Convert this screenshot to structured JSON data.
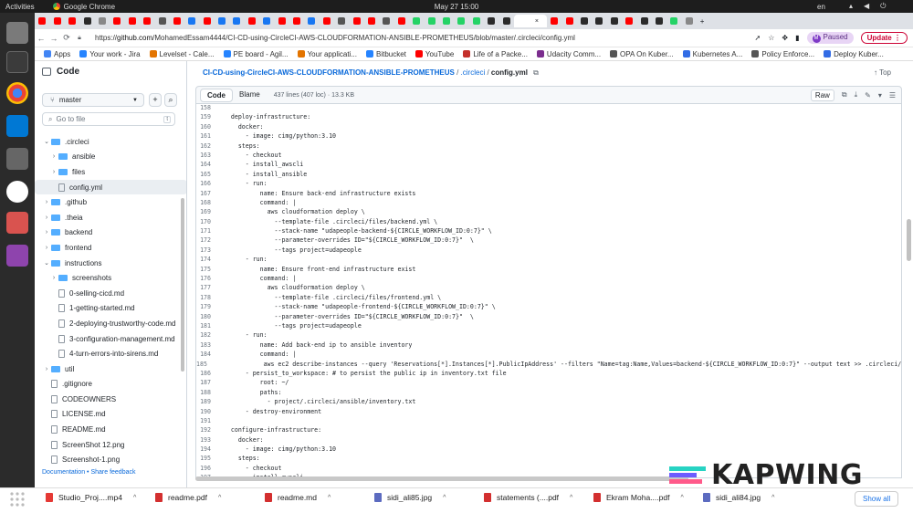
{
  "system": {
    "activities": "Activities",
    "app_name": "Google Chrome",
    "clock": "May 27  15:00",
    "lang": "en"
  },
  "browser": {
    "url_prefix": "https://",
    "url_host": "github.com",
    "url_path": "/MohamedEssam4444/CI-CD-using-CircleCI-AWS-CLOUDFORMATION-ANSIBLE-PROMETHEUS/blob/master/.circleci/config.yml",
    "paused_label": "Paused",
    "update_label": "Update",
    "avatar_letter": "M"
  },
  "bookmarks": [
    {
      "label": "Apps",
      "color": "#4285f4"
    },
    {
      "label": "Your work - Jira",
      "color": "#2684ff"
    },
    {
      "label": "Levelset - Cale...",
      "color": "#e37400"
    },
    {
      "label": "PE board - Agil...",
      "color": "#2684ff"
    },
    {
      "label": "Your applicati...",
      "color": "#e37400"
    },
    {
      "label": "Bitbucket",
      "color": "#2684ff"
    },
    {
      "label": "YouTube",
      "color": "#ff0000"
    },
    {
      "label": "Life of a Packe...",
      "color": "#c4302b"
    },
    {
      "label": "Udacity Comm...",
      "color": "#7b2d8e"
    },
    {
      "label": "OPA On Kuber...",
      "color": "#555555"
    },
    {
      "label": "Kubernetes A...",
      "color": "#326ce5"
    },
    {
      "label": "Policy Enforce...",
      "color": "#555555"
    },
    {
      "label": "Deploy Kuber...",
      "color": "#326ce5"
    }
  ],
  "sidebar": {
    "title": "Code",
    "branch": "master",
    "goto_placeholder": "Go to file",
    "goto_shortcut": "t",
    "tree": [
      {
        "label": ".circleci",
        "type": "folder",
        "depth": 0,
        "open": true
      },
      {
        "label": "ansible",
        "type": "folder",
        "depth": 1,
        "open": false
      },
      {
        "label": "files",
        "type": "folder",
        "depth": 1,
        "open": false
      },
      {
        "label": "config.yml",
        "type": "file",
        "depth": 1,
        "selected": true
      },
      {
        "label": ".github",
        "type": "folder",
        "depth": 0,
        "open": false
      },
      {
        "label": ".theia",
        "type": "folder",
        "depth": 0,
        "open": false
      },
      {
        "label": "backend",
        "type": "folder",
        "depth": 0,
        "open": false
      },
      {
        "label": "frontend",
        "type": "folder",
        "depth": 0,
        "open": false
      },
      {
        "label": "instructions",
        "type": "folder",
        "depth": 0,
        "open": true
      },
      {
        "label": "screenshots",
        "type": "folder",
        "depth": 1,
        "open": false
      },
      {
        "label": "0-selling-cicd.md",
        "type": "file",
        "depth": 1
      },
      {
        "label": "1-getting-started.md",
        "type": "file",
        "depth": 1
      },
      {
        "label": "2-deploying-trustworthy-code.md",
        "type": "file",
        "depth": 1
      },
      {
        "label": "3-configuration-management.md",
        "type": "file",
        "depth": 1
      },
      {
        "label": "4-turn-errors-into-sirens.md",
        "type": "file",
        "depth": 1
      },
      {
        "label": "util",
        "type": "folder",
        "depth": 0,
        "open": false
      },
      {
        "label": ".gitignore",
        "type": "file",
        "depth": 0
      },
      {
        "label": "CODEOWNERS",
        "type": "file",
        "depth": 0
      },
      {
        "label": "LICENSE.md",
        "type": "file",
        "depth": 0
      },
      {
        "label": "README.md",
        "type": "file",
        "depth": 0
      },
      {
        "label": "ScreenShot 12.png",
        "type": "file",
        "depth": 0
      },
      {
        "label": "Screenshot-1.png",
        "type": "file",
        "depth": 0
      }
    ],
    "footer_doc": "Documentation",
    "footer_sep": "•",
    "footer_feedback": "Share feedback"
  },
  "file": {
    "repo": "CI-CD-using-CircleCI-AWS-CLOUDFORMATION-ANSIBLE-PROMETHEUS",
    "folder": ".circleci",
    "name": "config.yml",
    "slash": "/",
    "top_label": "Top",
    "tab_code": "Code",
    "tab_blame": "Blame",
    "meta": "437 lines (407 loc) · 13.3 KB",
    "raw_label": "Raw"
  },
  "code_lines": [
    {
      "n": "158",
      "t": ""
    },
    {
      "n": "159",
      "t": "    deploy-infrastructure:"
    },
    {
      "n": "160",
      "t": "      docker:"
    },
    {
      "n": "161",
      "t": "        - image: cimg/python:3.10"
    },
    {
      "n": "162",
      "t": "      steps:"
    },
    {
      "n": "163",
      "t": "        - checkout"
    },
    {
      "n": "164",
      "t": "        - install_awscli"
    },
    {
      "n": "165",
      "t": "        - install_ansible"
    },
    {
      "n": "166",
      "t": "        - run:"
    },
    {
      "n": "167",
      "t": "            name: Ensure back-end infrastructure exists"
    },
    {
      "n": "168",
      "t": "            command: |"
    },
    {
      "n": "169",
      "t": "              aws cloudformation deploy \\"
    },
    {
      "n": "170",
      "t": "                --template-file .circleci/files/backend.yml \\"
    },
    {
      "n": "171",
      "t": "                --stack-name \"udapeople-backend-${CIRCLE_WORKFLOW_ID:0:7}\" \\"
    },
    {
      "n": "172",
      "t": "                --parameter-overrides ID=\"${CIRCLE_WORKFLOW_ID:0:7}\"  \\"
    },
    {
      "n": "173",
      "t": "                --tags project=udapeople"
    },
    {
      "n": "174",
      "t": "        - run:"
    },
    {
      "n": "175",
      "t": "            name: Ensure front-end infrastructure exist"
    },
    {
      "n": "176",
      "t": "            command: |"
    },
    {
      "n": "177",
      "t": "              aws cloudformation deploy \\"
    },
    {
      "n": "178",
      "t": "                --template-file .circleci/files/frontend.yml \\"
    },
    {
      "n": "179",
      "t": "                --stack-name \"udapeople-frontend-${CIRCLE_WORKFLOW_ID:0:7}\" \\"
    },
    {
      "n": "180",
      "t": "                --parameter-overrides ID=\"${CIRCLE_WORKFLOW_ID:0:7}\"  \\"
    },
    {
      "n": "181",
      "t": "                --tags project=udapeople"
    },
    {
      "n": "182",
      "t": "        - run:"
    },
    {
      "n": "183",
      "t": "            name: Add back-end ip to ansible inventory"
    },
    {
      "n": "184",
      "t": "            command: |"
    },
    {
      "n": "185",
      "t": "              aws ec2 describe-instances --query 'Reservations[*].Instances[*].PublicIpAddress' --filters \"Name=tag:Name,Values=backend-${CIRCLE_WORKFLOW_ID:0:7}\" --output text >> .circleci/ansibl"
    },
    {
      "n": "186",
      "t": "        - persist_to_workspace: # to persist the public ip in inventory.txt file"
    },
    {
      "n": "187",
      "t": "            root: ~/"
    },
    {
      "n": "188",
      "t": "            paths:"
    },
    {
      "n": "189",
      "t": "              - project/.circleci/ansible/inventory.txt"
    },
    {
      "n": "190",
      "t": "        - destroy-environment"
    },
    {
      "n": "191",
      "t": ""
    },
    {
      "n": "192",
      "t": "    configure-infrastructure:"
    },
    {
      "n": "193",
      "t": "      docker:"
    },
    {
      "n": "194",
      "t": "        - image: cimg/python:3.10"
    },
    {
      "n": "195",
      "t": "      steps:"
    },
    {
      "n": "196",
      "t": "        - checkout"
    },
    {
      "n": "197",
      "t": "        - install_awscli"
    }
  ],
  "watermark": {
    "text": "KAPWING",
    "colors": [
      "#27d3c3",
      "#6d5cff",
      "#ff5a8a"
    ]
  },
  "downloads": [
    {
      "label": "Studio_Proj....mp4",
      "color": "#e53935"
    },
    {
      "label": "readme.pdf",
      "color": "#d32f2f"
    },
    {
      "label": "readme.md",
      "color": "#d32f2f"
    },
    {
      "label": "sidi_ali85.jpg",
      "color": "#5c6bc0"
    },
    {
      "label": "statements (....pdf",
      "color": "#d32f2f"
    },
    {
      "label": "Ekram Moha....pdf",
      "color": "#d32f2f"
    },
    {
      "label": "sidi_ali84.jpg",
      "color": "#5c6bc0"
    }
  ],
  "show_all": "Show all"
}
